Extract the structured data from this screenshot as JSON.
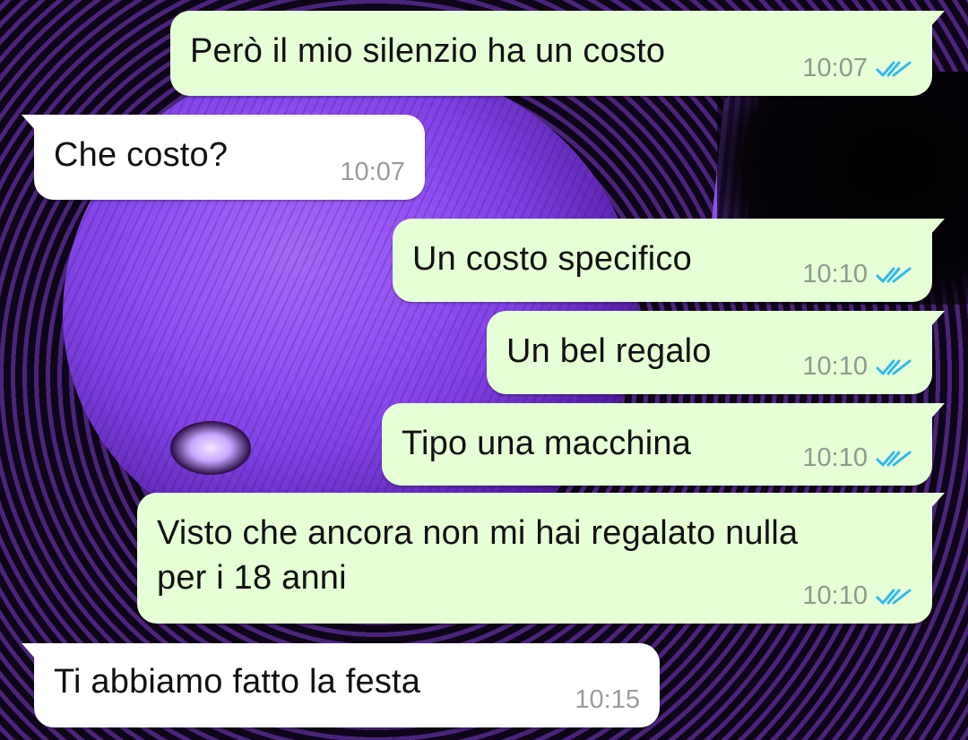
{
  "chat": {
    "messages": [
      {
        "id": "m1",
        "direction": "outgoing",
        "text": "Però il mio silenzio ha un costo",
        "time": "10:07",
        "status": "read"
      },
      {
        "id": "m2",
        "direction": "incoming",
        "text": "Che costo?",
        "time": "10:07"
      },
      {
        "id": "m3",
        "direction": "outgoing",
        "text": "Un costo specifico",
        "time": "10:10",
        "status": "read"
      },
      {
        "id": "m4",
        "direction": "outgoing",
        "text": "Un bel regalo",
        "time": "10:10",
        "status": "read"
      },
      {
        "id": "m5",
        "direction": "outgoing",
        "text": "Tipo una macchina",
        "time": "10:10",
        "status": "read"
      },
      {
        "id": "m6",
        "direction": "outgoing",
        "text": "Visto che ancora non mi hai regalato nulla\nper i 18 anni",
        "time": "10:10",
        "status": "read"
      },
      {
        "id": "m7",
        "direction": "incoming",
        "text": "Ti abbiamo fatto la festa",
        "time": "10:15"
      }
    ]
  },
  "colors": {
    "outgoing_bubble": "#e6ffd6",
    "incoming_bubble": "#ffffff",
    "read_ticks": "#34b7f1",
    "timestamp": "#8f9a8b",
    "wallpaper_accent": "#8a52e6"
  },
  "icons": {
    "read_receipt": "double-check-icon"
  }
}
